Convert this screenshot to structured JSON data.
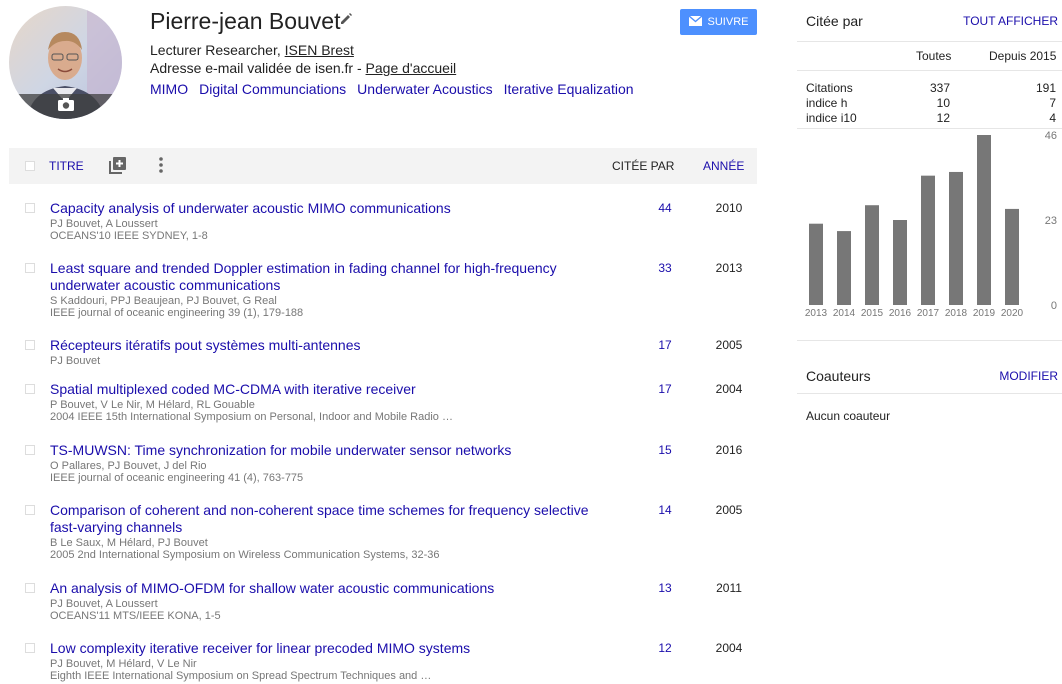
{
  "profile": {
    "name": "Pierre-jean Bouvet",
    "affiliation_prefix": "Lecturer Researcher, ",
    "affiliation_link": "ISEN Brest",
    "email_prefix": "Adresse e-mail validée de isen.fr - ",
    "homepage_link": "Page d'accueil",
    "interests": [
      "MIMO",
      "Digital Communciations",
      "Underwater Acoustics",
      "Iterative Equalization"
    ],
    "follow_label": "SUIVRE"
  },
  "table": {
    "title_header": "TITRE",
    "cited_header": "CITÉE PAR",
    "year_header": "ANNÉE",
    "rows": [
      {
        "title": "Capacity analysis of underwater acoustic MIMO communications",
        "authors": "PJ Bouvet, A Loussert",
        "venue": "OCEANS'10 IEEE SYDNEY, 1-8",
        "cites": "44",
        "year": "2010"
      },
      {
        "title": "Least square and trended Doppler estimation in fading channel for high-frequency underwater acoustic communications",
        "authors": "S Kaddouri, PPJ Beaujean, PJ Bouvet, G Real",
        "venue": "IEEE journal of oceanic engineering 39 (1), 179-188",
        "cites": "33",
        "year": "2013"
      },
      {
        "title": "Récepteurs itératifs pout systèmes multi-antennes",
        "authors": "PJ Bouvet",
        "venue": "",
        "cites": "17",
        "year": "2005"
      },
      {
        "title": "Spatial multiplexed coded MC-CDMA with iterative receiver",
        "authors": "P Bouvet, V Le Nir, M Hélard, RL Gouable",
        "venue": "2004 IEEE 15th International Symposium on Personal, Indoor and Mobile Radio …",
        "cites": "17",
        "year": "2004"
      },
      {
        "title": "TS-MUWSN: Time synchronization for mobile underwater sensor networks",
        "authors": "O Pallares, PJ Bouvet, J del Rio",
        "venue": "IEEE journal of oceanic engineering 41 (4), 763-775",
        "cites": "15",
        "year": "2016"
      },
      {
        "title": "Comparison of coherent and non-coherent space time schemes for frequency selective fast-varying channels",
        "authors": "B Le Saux, M Hélard, PJ Bouvet",
        "venue": "2005 2nd International Symposium on Wireless Communication Systems, 32-36",
        "cites": "14",
        "year": "2005"
      },
      {
        "title": "An analysis of MIMO-OFDM for shallow water acoustic communications",
        "authors": "PJ Bouvet, A Loussert",
        "venue": "OCEANS'11 MTS/IEEE KONA, 1-5",
        "cites": "13",
        "year": "2011"
      },
      {
        "title": "Low complexity iterative receiver for linear precoded MIMO systems",
        "authors": "PJ Bouvet, M Hélard, V Le Nir",
        "venue": "Eighth IEEE International Symposium on Spread Spectrum Techniques and …",
        "cites": "12",
        "year": "2004"
      }
    ]
  },
  "cited_by": {
    "title": "Citée par",
    "view_all": "TOUT AFFICHER",
    "col_all": "Toutes",
    "col_since": "Depuis 2015",
    "stats": [
      {
        "label": "Citations",
        "all": "337",
        "since": "191"
      },
      {
        "label": "indice h",
        "all": "10",
        "since": "7"
      },
      {
        "label": "indice i10",
        "all": "12",
        "since": "4"
      }
    ]
  },
  "chart_data": {
    "type": "bar",
    "categories": [
      "2013",
      "2014",
      "2015",
      "2016",
      "2017",
      "2018",
      "2019",
      "2020"
    ],
    "values": [
      22,
      20,
      27,
      23,
      35,
      36,
      46,
      26
    ],
    "ylim": [
      0,
      46
    ],
    "yticks": [
      "46",
      "23",
      "0"
    ],
    "bar_color": "#777777"
  },
  "coauthors": {
    "title": "Coauteurs",
    "edit": "MODIFIER",
    "empty": "Aucun coauteur"
  }
}
